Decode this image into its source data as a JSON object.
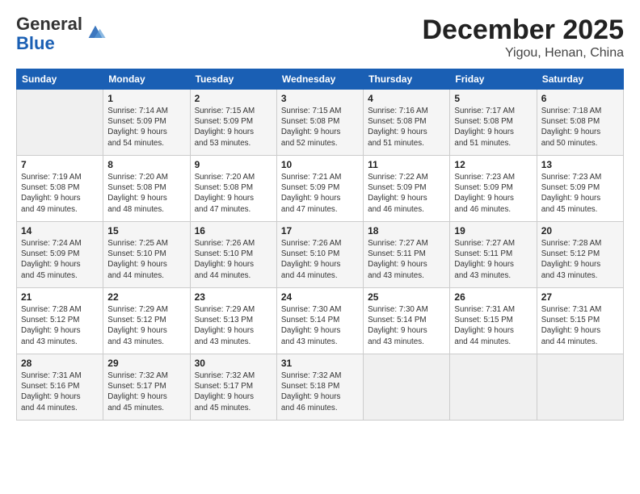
{
  "header": {
    "logo_general": "General",
    "logo_blue": "Blue",
    "title": "December 2025",
    "subtitle": "Yigou, Henan, China"
  },
  "weekdays": [
    "Sunday",
    "Monday",
    "Tuesday",
    "Wednesday",
    "Thursday",
    "Friday",
    "Saturday"
  ],
  "weeks": [
    [
      {
        "day": "",
        "detail": ""
      },
      {
        "day": "1",
        "detail": "Sunrise: 7:14 AM\nSunset: 5:09 PM\nDaylight: 9 hours\nand 54 minutes."
      },
      {
        "day": "2",
        "detail": "Sunrise: 7:15 AM\nSunset: 5:09 PM\nDaylight: 9 hours\nand 53 minutes."
      },
      {
        "day": "3",
        "detail": "Sunrise: 7:15 AM\nSunset: 5:08 PM\nDaylight: 9 hours\nand 52 minutes."
      },
      {
        "day": "4",
        "detail": "Sunrise: 7:16 AM\nSunset: 5:08 PM\nDaylight: 9 hours\nand 51 minutes."
      },
      {
        "day": "5",
        "detail": "Sunrise: 7:17 AM\nSunset: 5:08 PM\nDaylight: 9 hours\nand 51 minutes."
      },
      {
        "day": "6",
        "detail": "Sunrise: 7:18 AM\nSunset: 5:08 PM\nDaylight: 9 hours\nand 50 minutes."
      }
    ],
    [
      {
        "day": "7",
        "detail": "Sunrise: 7:19 AM\nSunset: 5:08 PM\nDaylight: 9 hours\nand 49 minutes."
      },
      {
        "day": "8",
        "detail": "Sunrise: 7:20 AM\nSunset: 5:08 PM\nDaylight: 9 hours\nand 48 minutes."
      },
      {
        "day": "9",
        "detail": "Sunrise: 7:20 AM\nSunset: 5:08 PM\nDaylight: 9 hours\nand 47 minutes."
      },
      {
        "day": "10",
        "detail": "Sunrise: 7:21 AM\nSunset: 5:09 PM\nDaylight: 9 hours\nand 47 minutes."
      },
      {
        "day": "11",
        "detail": "Sunrise: 7:22 AM\nSunset: 5:09 PM\nDaylight: 9 hours\nand 46 minutes."
      },
      {
        "day": "12",
        "detail": "Sunrise: 7:23 AM\nSunset: 5:09 PM\nDaylight: 9 hours\nand 46 minutes."
      },
      {
        "day": "13",
        "detail": "Sunrise: 7:23 AM\nSunset: 5:09 PM\nDaylight: 9 hours\nand 45 minutes."
      }
    ],
    [
      {
        "day": "14",
        "detail": "Sunrise: 7:24 AM\nSunset: 5:09 PM\nDaylight: 9 hours\nand 45 minutes."
      },
      {
        "day": "15",
        "detail": "Sunrise: 7:25 AM\nSunset: 5:10 PM\nDaylight: 9 hours\nand 44 minutes."
      },
      {
        "day": "16",
        "detail": "Sunrise: 7:26 AM\nSunset: 5:10 PM\nDaylight: 9 hours\nand 44 minutes."
      },
      {
        "day": "17",
        "detail": "Sunrise: 7:26 AM\nSunset: 5:10 PM\nDaylight: 9 hours\nand 44 minutes."
      },
      {
        "day": "18",
        "detail": "Sunrise: 7:27 AM\nSunset: 5:11 PM\nDaylight: 9 hours\nand 43 minutes."
      },
      {
        "day": "19",
        "detail": "Sunrise: 7:27 AM\nSunset: 5:11 PM\nDaylight: 9 hours\nand 43 minutes."
      },
      {
        "day": "20",
        "detail": "Sunrise: 7:28 AM\nSunset: 5:12 PM\nDaylight: 9 hours\nand 43 minutes."
      }
    ],
    [
      {
        "day": "21",
        "detail": "Sunrise: 7:28 AM\nSunset: 5:12 PM\nDaylight: 9 hours\nand 43 minutes."
      },
      {
        "day": "22",
        "detail": "Sunrise: 7:29 AM\nSunset: 5:12 PM\nDaylight: 9 hours\nand 43 minutes."
      },
      {
        "day": "23",
        "detail": "Sunrise: 7:29 AM\nSunset: 5:13 PM\nDaylight: 9 hours\nand 43 minutes."
      },
      {
        "day": "24",
        "detail": "Sunrise: 7:30 AM\nSunset: 5:14 PM\nDaylight: 9 hours\nand 43 minutes."
      },
      {
        "day": "25",
        "detail": "Sunrise: 7:30 AM\nSunset: 5:14 PM\nDaylight: 9 hours\nand 43 minutes."
      },
      {
        "day": "26",
        "detail": "Sunrise: 7:31 AM\nSunset: 5:15 PM\nDaylight: 9 hours\nand 44 minutes."
      },
      {
        "day": "27",
        "detail": "Sunrise: 7:31 AM\nSunset: 5:15 PM\nDaylight: 9 hours\nand 44 minutes."
      }
    ],
    [
      {
        "day": "28",
        "detail": "Sunrise: 7:31 AM\nSunset: 5:16 PM\nDaylight: 9 hours\nand 44 minutes."
      },
      {
        "day": "29",
        "detail": "Sunrise: 7:32 AM\nSunset: 5:17 PM\nDaylight: 9 hours\nand 45 minutes."
      },
      {
        "day": "30",
        "detail": "Sunrise: 7:32 AM\nSunset: 5:17 PM\nDaylight: 9 hours\nand 45 minutes."
      },
      {
        "day": "31",
        "detail": "Sunrise: 7:32 AM\nSunset: 5:18 PM\nDaylight: 9 hours\nand 46 minutes."
      },
      {
        "day": "",
        "detail": ""
      },
      {
        "day": "",
        "detail": ""
      },
      {
        "day": "",
        "detail": ""
      }
    ]
  ]
}
